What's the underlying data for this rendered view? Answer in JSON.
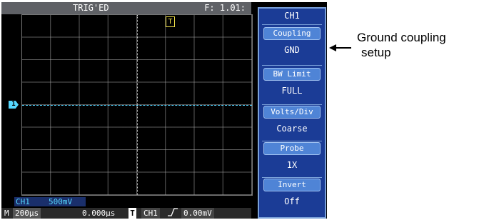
{
  "top_bar": {
    "status": "TRIG'ED",
    "frequency": "F: 1.01:"
  },
  "markers": {
    "channel1": "1",
    "trigger": "T"
  },
  "channel_scale": {
    "channel": "CH1",
    "volts_div": "500mV"
  },
  "bottom_bar": {
    "mode": "M",
    "timebase": "200µs",
    "position": "0.000µs",
    "trigger_icon": "T",
    "trigger_source": "CH1",
    "trigger_slope_icon": "rising-edge-icon",
    "trigger_level": "0.00mV"
  },
  "menu": {
    "title": "CH1",
    "items": [
      {
        "label": "Coupling",
        "value": "GND"
      },
      {
        "label": "BW Limit",
        "value": "FULL"
      },
      {
        "label": "Volts/Div",
        "value": "Coarse"
      },
      {
        "label": "Probe",
        "value": "1X"
      },
      {
        "label": "Invert",
        "value": "Off"
      }
    ]
  },
  "annotation": {
    "line1": "Ground coupling",
    "line2": "setup"
  },
  "colors": {
    "trace": "#4fd2ff",
    "trigger_marker": "#f2e14a",
    "menu_bg": "#1b3c96",
    "menu_button": "#4f84d6"
  }
}
